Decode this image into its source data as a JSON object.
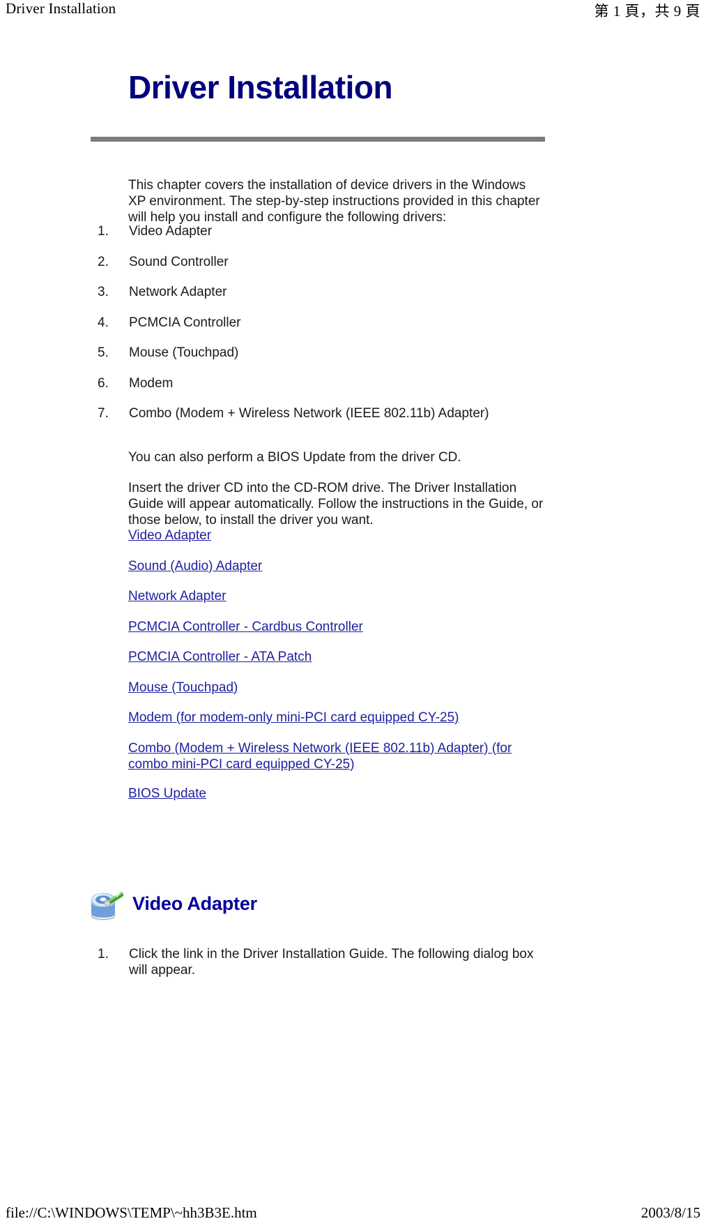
{
  "page_header": {
    "left": "Driver Installation",
    "right": "第 1 頁，共 9 頁"
  },
  "page_footer": {
    "left": "file://C:\\WINDOWS\\TEMP\\~hh3B3E.htm",
    "right": "2003/8/15"
  },
  "document": {
    "title": "Driver Installation",
    "title_color": "#00007c",
    "rule_color": "#7b7b7b",
    "link_color": "#2020a0",
    "intro_paragraph": "This chapter covers the installation of device drivers in the Windows XP environment. The step-by-step instructions provided in this chapter will help you install and configure the following drivers:",
    "driver_list": [
      {
        "num": "1.",
        "label": "Video Adapter"
      },
      {
        "num": "2.",
        "label": "Sound Controller"
      },
      {
        "num": "3.",
        "label": "Network Adapter"
      },
      {
        "num": "4.",
        "label": "PCMCIA Controller"
      },
      {
        "num": "5.",
        "label": "Mouse (Touchpad)"
      },
      {
        "num": "6.",
        "label": "Modem"
      },
      {
        "num": "7.",
        "label": "Combo (Modem + Wireless Network (IEEE 802.11b) Adapter)"
      }
    ],
    "bios_note": "You can also perform a BIOS Update from the driver CD.",
    "insert_paragraph": "Insert the driver CD into the CD-ROM drive. The Driver Installation Guide will appear automatically. Follow the instructions in the Guide, or those below, to install the driver you want.",
    "links": [
      {
        "label": "Video Adapter",
        "wrap": false
      },
      {
        "label": "Sound (Audio) Adapter",
        "wrap": false
      },
      {
        "label": "Network Adapter",
        "wrap": false
      },
      {
        "label": "PCMCIA Controller - Cardbus Controller",
        "wrap": false
      },
      {
        "label": "PCMCIA Controller - ATA Patch",
        "wrap": false
      },
      {
        "label": "Mouse (Touchpad)",
        "wrap": false
      },
      {
        "label": "Modem (for modem-only mini-PCI card equipped CY-25)",
        "wrap": false
      },
      {
        "label": "Combo (Modem + Wireless Network (IEEE 802.11b) Adapter) (for combo mini-PCI card equipped CY-25)",
        "wrap": true
      },
      {
        "label": "BIOS Update",
        "wrap": false
      }
    ],
    "section": {
      "icon": "driver-install-wizard-icon",
      "title": "Video Adapter",
      "steps": [
        {
          "num": "1.",
          "text": "Click the link in the Driver Installation Guide. The following dialog box will appear."
        }
      ]
    }
  }
}
